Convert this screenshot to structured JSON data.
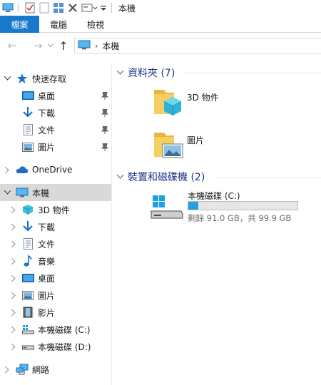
{
  "window": {
    "title": "本機"
  },
  "ribbon": {
    "tabs": [
      "檔案",
      "電腦",
      "檢視"
    ]
  },
  "address": {
    "crumb": "本機"
  },
  "sidebar": {
    "quick_access": "快速存取",
    "quick_items": [
      "桌面",
      "下載",
      "文件",
      "圖片"
    ],
    "onedrive": "OneDrive",
    "this_pc": "本機",
    "pc_items": [
      "3D 物件",
      "下載",
      "文件",
      "音樂",
      "桌面",
      "圖片",
      "影片",
      "本機磁碟 (C:)",
      "本機磁碟 (D:)"
    ],
    "network": "網路"
  },
  "main": {
    "folders_header": "資料夾 (7)",
    "folders": [
      "3D 物件",
      "圖片"
    ],
    "devices_header": "裝置和磁碟機 (2)",
    "drive": {
      "name": "本機磁碟 (C:)",
      "space": "剩餘 91.0 GB，共 99.9 GB",
      "used_fraction": 0.089
    }
  },
  "colors": {
    "accent": "#1979ca",
    "header_blue": "#1e3287",
    "drive_fill": "#26a0da",
    "folder": "#f0c24f"
  }
}
